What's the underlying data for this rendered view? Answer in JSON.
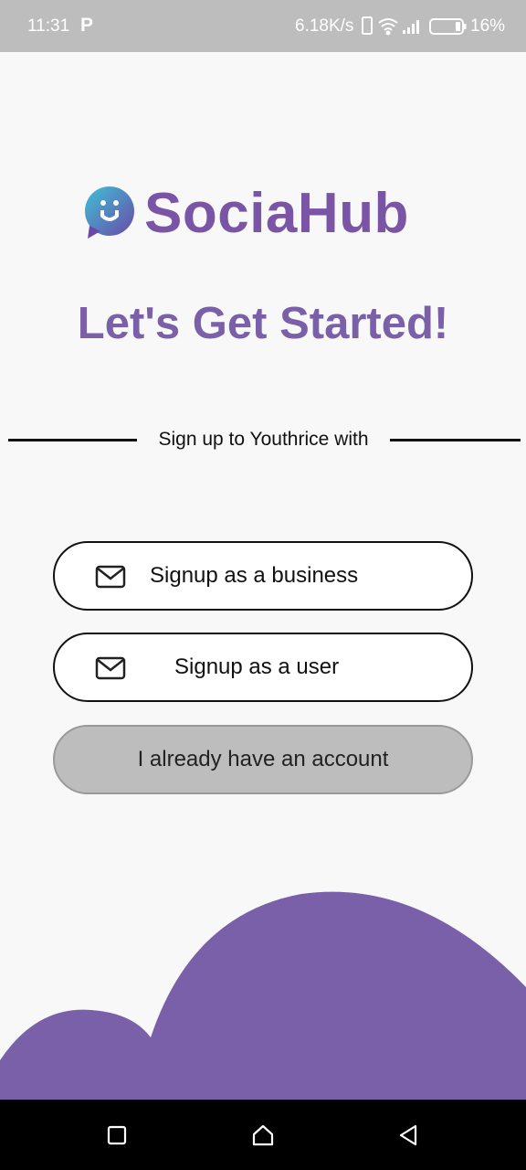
{
  "status_bar": {
    "time": "11:31",
    "notification_icon": "P",
    "network_speed": "6.18K/s",
    "battery_percent": "16%",
    "icons": [
      "phone-icon",
      "wifi-icon",
      "signal-icon",
      "battery-icon"
    ]
  },
  "logo": {
    "text": "SociaHub",
    "icon": "chat-bubble-logo-icon"
  },
  "headline": "Let's Get Started!",
  "divider_text": "Sign up to Youthrice with",
  "buttons": {
    "business_label": "Signup as a business",
    "user_label": "Signup as a user",
    "account_label": "I already have an account",
    "icon": "mail-icon"
  },
  "colors": {
    "brand_purple": "#7a60a8",
    "status_bar": "#bdbdbd",
    "account_button": "#bdbdbd"
  },
  "nav_bar": {
    "icons": [
      "recent-apps-icon",
      "home-icon",
      "back-icon"
    ]
  }
}
